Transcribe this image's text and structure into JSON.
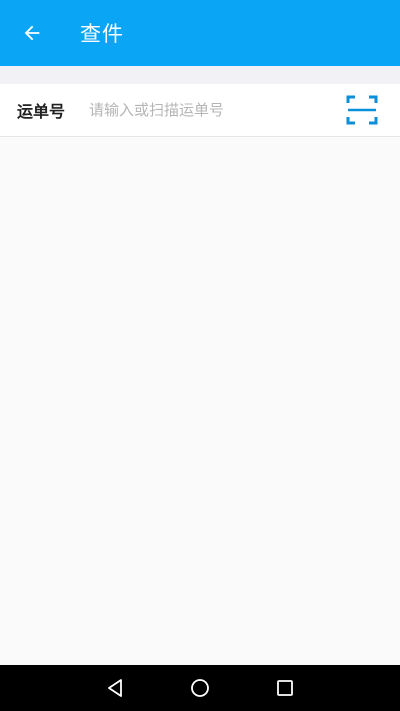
{
  "app_bar": {
    "title": "查件",
    "background_color": "#0aa5f5",
    "back_icon": "arrow-left-icon"
  },
  "waybill_field": {
    "label": "运单号",
    "value": "",
    "placeholder": "请输入或扫描运单号",
    "scan_icon": "scan-icon",
    "scan_icon_color": "#0a8fd9"
  },
  "system_nav": {
    "back_icon": "nav-back-icon",
    "home_icon": "nav-home-icon",
    "recents_icon": "nav-recents-icon"
  }
}
